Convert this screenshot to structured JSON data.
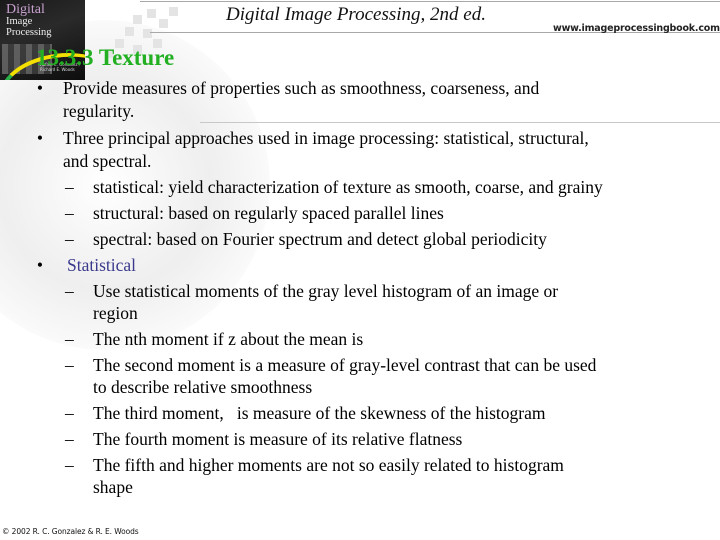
{
  "header": {
    "title": "Digital Image Processing, 2nd ed.",
    "url": "www.imageprocessingbook.com"
  },
  "cover": {
    "title_line1": "Digital",
    "title_line2": "Image",
    "title_line3": "Processing",
    "authors": "Rafael C. Gonzalez / Richard E. Woods"
  },
  "section": {
    "title": "13.3.3 Texture"
  },
  "bullets": [
    {
      "text": "Provide measures of properties such as smoothness, coarseness, and",
      "continuation": "regularity."
    },
    {
      "text": "Three principal approaches used in image processing: statistical, structural,",
      "continuation": "and spectral.",
      "sub": [
        {
          "text": "statistical: yield characterization of texture as smooth, coarse, and grainy"
        },
        {
          "text": "structural: based on regularly spaced parallel lines"
        },
        {
          "text": "spectral: based on Fourier spectrum and detect global periodicity"
        }
      ]
    },
    {
      "text": "Statistical",
      "color": "#3a3a8c",
      "sub": [
        {
          "text": "Use statistical moments of the gray level histogram of an image or",
          "continuation": "region"
        },
        {
          "text": "The nth moment if z about the mean is"
        },
        {
          "text": "The second moment is a measure of gray-level contrast that can be used",
          "continuation": "to describe relative smoothness"
        },
        {
          "text": "The third moment,   is measure of the skewness of the histogram"
        },
        {
          "text": "The fourth moment is measure of its relative flatness"
        },
        {
          "text": "The fifth and higher moments are not so easily related to histogram",
          "continuation": "shape"
        }
      ]
    }
  ],
  "glyphs": {
    "bullet": "•",
    "dash": "–"
  },
  "footer": {
    "copyright": "© 2002 R. C. Gonzalez & R. E. Woods"
  },
  "colors": {
    "section_title": "#22b022",
    "statistical_heading": "#3a3a8c"
  }
}
